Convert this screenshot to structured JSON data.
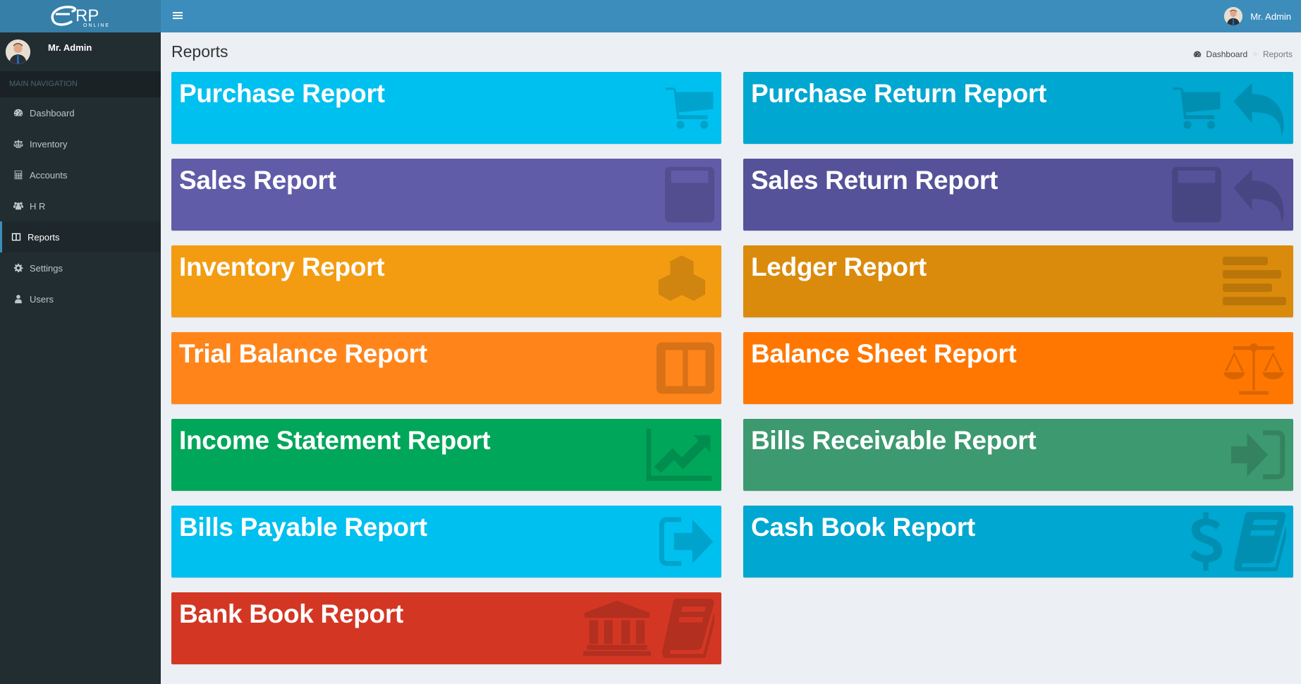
{
  "app": {
    "logo_text": "eRP",
    "logo_subtext": "ONLINE"
  },
  "sidebar": {
    "user_name": "Mr. Admin",
    "nav_header": "MAIN NAVIGATION",
    "items": [
      {
        "label": "Dashboard",
        "icon": "dashboard-icon",
        "active": false
      },
      {
        "label": "Inventory",
        "icon": "balance-scale-icon",
        "active": false
      },
      {
        "label": "Accounts",
        "icon": "calculator-icon",
        "active": false
      },
      {
        "label": "H R",
        "icon": "users-group-icon",
        "active": false
      },
      {
        "label": "Reports",
        "icon": "columns-icon",
        "active": true
      },
      {
        "label": "Settings",
        "icon": "gear-icon",
        "active": false
      },
      {
        "label": "Users",
        "icon": "user-icon",
        "active": false
      }
    ]
  },
  "header": {
    "user_name": "Mr. Admin"
  },
  "page": {
    "title": "Reports",
    "breadcrumb": [
      {
        "label": "Dashboard",
        "icon": "dashboard-icon"
      },
      {
        "label": "Reports"
      }
    ],
    "breadcrumb_separator": ">"
  },
  "tiles": [
    {
      "title": "Purchase Report",
      "color": "#00c0ef",
      "icons": [
        "cart-icon"
      ]
    },
    {
      "title": "Purchase Return Report",
      "color": "#00a7d0",
      "icons": [
        "cart-icon",
        "reply-icon"
      ]
    },
    {
      "title": "Sales Report",
      "color": "#605ca8",
      "icons": [
        "calculator-icon"
      ]
    },
    {
      "title": "Sales Return Report",
      "color": "#555299",
      "icons": [
        "calculator-icon",
        "reply-icon"
      ]
    },
    {
      "title": "Inventory Report",
      "color": "#f39c12",
      "icons": [
        "cubes-icon"
      ]
    },
    {
      "title": "Ledger Report",
      "color": "#db8b0b",
      "icons": [
        "align-left-icon"
      ]
    },
    {
      "title": "Trial Balance Report",
      "color": "#ff851b",
      "icons": [
        "columns-icon"
      ]
    },
    {
      "title": "Balance Sheet Report",
      "color": "#ff7701",
      "icons": [
        "balance-scale-icon"
      ]
    },
    {
      "title": "Income Statement Report",
      "color": "#00a65a",
      "icons": [
        "line-chart-icon"
      ]
    },
    {
      "title": "Bills Receivable Report",
      "color": "#3d9970",
      "icons": [
        "sign-in-icon"
      ]
    },
    {
      "title": "Bills Payable Report",
      "color": "#00c0ef",
      "icons": [
        "sign-out-icon"
      ]
    },
    {
      "title": "Cash Book Report",
      "color": "#00a7d0",
      "icons": [
        "dollar-icon",
        "book-icon"
      ]
    },
    {
      "title": "Bank Book Report",
      "color": "#d33724",
      "icons": [
        "bank-icon",
        "book-icon"
      ]
    }
  ]
}
